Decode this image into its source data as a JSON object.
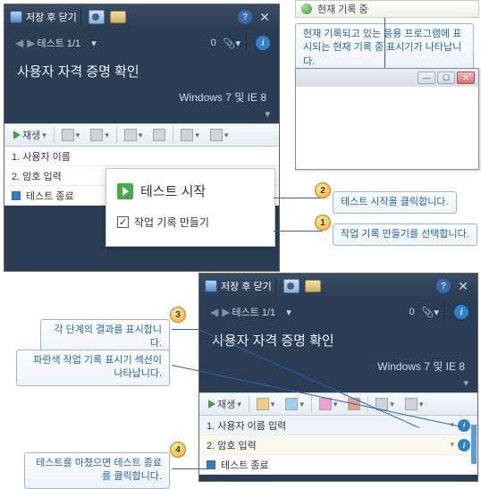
{
  "panel1": {
    "title": "저장 후 닫기",
    "nav": {
      "label": "테스트 1/1",
      "count": "0"
    },
    "test_title": "사용자 자격 증명 확인",
    "env": "Windows 7 및 IE 8",
    "toolbar": {
      "play_label": "재생"
    },
    "steps": [
      "1. 사용자 이름",
      "2. 암호 입력",
      "테스트 종료"
    ]
  },
  "popup": {
    "start": "테스트 시작",
    "checkbox": "작업 기록 만들기"
  },
  "rec_indicator": "현재 기록 중",
  "callouts": {
    "c_rec": "현재 기록되고 있는 응용 프로그램에 표시되는 현재 기록 중 표시기가 나타납니다.",
    "c2": "테스트 시작을 클릭합니다.",
    "c1": "작업 기록 만들기를 선택합니다.",
    "c3": "각 단계의 결과를 표시합니다.",
    "c_blue": "파란색 작업 기록 표시기 섹션이 나타납니다.",
    "c4": "테스트를 마쳤으면 테스트 종료를 클릭합니다."
  },
  "panel2": {
    "title": "저장 후 닫기",
    "nav": {
      "label": "테스트 1/1",
      "count": "0"
    },
    "test_title": "사용자 자격 증명 확인",
    "env": "Windows 7 및 IE 8",
    "toolbar": {
      "play_label": "재생"
    },
    "steps": [
      "1. 사용자 이름 입력",
      "2. 암호 입력",
      "테스트 종료"
    ]
  },
  "badges": {
    "b1": "1",
    "b2": "2",
    "b3": "3",
    "b4": "4"
  }
}
